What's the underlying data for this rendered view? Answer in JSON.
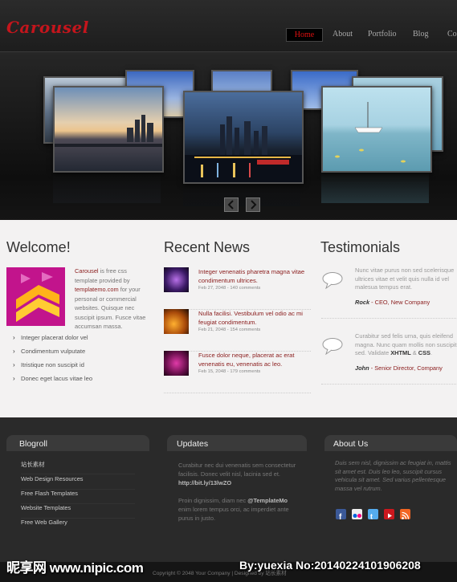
{
  "header": {
    "logo": "Carousel",
    "nav": [
      {
        "label": "Home",
        "active": true
      },
      {
        "label": "About"
      },
      {
        "label": "Portfolio"
      },
      {
        "label": "Blog"
      },
      {
        "label": "Co"
      }
    ]
  },
  "carousel": {
    "prev_icon": "chevron-left-icon",
    "next_icon": "chevron-right-icon"
  },
  "welcome": {
    "title": "Welcome!",
    "brand": "Carousel",
    "text1": " is free css template provided by ",
    "link": "templatemo.com",
    "text2": " for your personal or commercial websites. Quisque nec suscipit ipsum. Fusce vitae accumsan massa.",
    "list": [
      "Integer placerat dolor vel",
      "Condimentum vulputate",
      "Itristique non suscipit id",
      "Donec eget lacus vitae leo"
    ]
  },
  "news": {
    "title": "Recent News",
    "items": [
      {
        "title": "Integer venenatis pharetra magna vitae condimentum  ultrices.",
        "meta": "Feb 27, 2048 - 140 comments"
      },
      {
        "title": "Nulla facilisi. Vestibulum vel odio ac mi feugiat condimentum.",
        "meta": "Feb 21, 2048 - 154 comments"
      },
      {
        "title": "Fusce dolor neque, placerat ac erat venenatis eu, venenatis ac leo.",
        "meta": "Feb 15, 2048 - 179 comments"
      }
    ]
  },
  "testimonials": {
    "title": "Testimonials",
    "items": [
      {
        "text": "Nunc vitae purus non sed scelerisque ultrices vitae et velit quis nulla id vel malesua tempus erat.",
        "name": "Rock",
        "role": " - CEO, New Company"
      },
      {
        "text_a": "Curabitur sed felis urna, quis eleifend magna. Nunc quam mollis non suscipit sed. Validate ",
        "xhtml": "XHTML",
        "amp": " & ",
        "css": "CSS",
        "dot": ".",
        "name": "John",
        "role": " - Senior Director, Company"
      }
    ]
  },
  "footer": {
    "blogroll": {
      "title": "Blogroll",
      "links": [
        "站长素材",
        "Web Design Resources",
        "Free Flash Templates",
        "Website Templates",
        "Free Web Gallery"
      ]
    },
    "updates": {
      "title": "Updates",
      "p1": "Curabitur nec dui venenatis sem consectetur facilisis. Donec velit nisl, lacinia sed et. ",
      "p1_link": "http://bit.ly/13lwZO",
      "p2a": "Proin dignissim, diam nec ",
      "p2_link": "@TemplateMo",
      "p2b": " enim lorem tempus orci, ac imperdiet ante purus in justo."
    },
    "about": {
      "title": "About Us",
      "text": "Duis sem nisl, dignissim ac feugiat in, mattis sit amet est. Duis leo leo, suscipit cursus vehicula sit amet. Sed varius pellentesque massa vel rutrum."
    },
    "social_icons": [
      "facebook-icon",
      "flickr-icon",
      "twitter-icon",
      "youtube-icon",
      "rss-icon"
    ],
    "copyright": "Copyright © 2048 Your Company | Designed by 站长素材"
  },
  "watermark": {
    "left": "昵享网 www.nipic.com",
    "right": "By:yuexia No:20140224101906208"
  }
}
